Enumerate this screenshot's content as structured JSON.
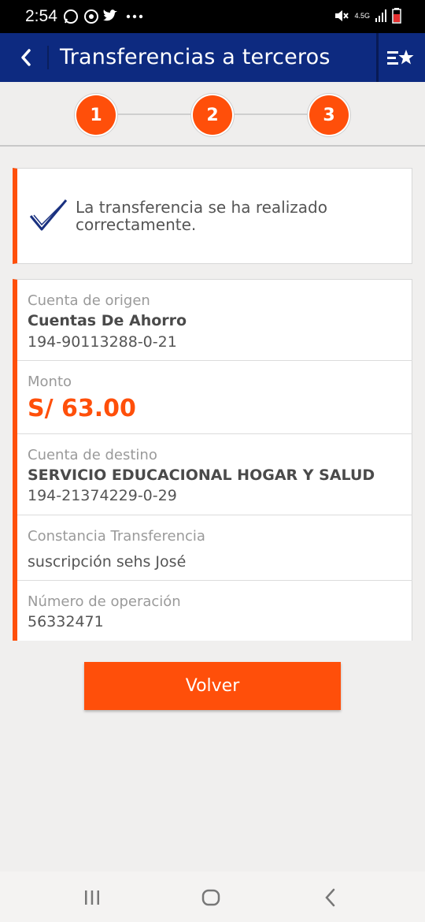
{
  "status": {
    "time": "2:54",
    "network": "4.5G"
  },
  "header": {
    "title": "Transferencias a terceros"
  },
  "stepper": {
    "steps": [
      "1",
      "2",
      "3"
    ]
  },
  "success": {
    "message": "La transferencia se ha realizado correctamente."
  },
  "details": {
    "origin": {
      "label": "Cuenta de origen",
      "name": "Cuentas De Ahorro",
      "number": "194-90113288-0-21"
    },
    "amount": {
      "label": "Monto",
      "value": "S/ 63.00"
    },
    "destination": {
      "label": "Cuenta de destino",
      "name": "SERVICIO EDUCACIONAL HOGAR Y SALUD",
      "number": "194-21374229-0-29"
    },
    "receipt": {
      "label": "Constancia Transferencia",
      "value": "suscripción sehs José"
    },
    "operation": {
      "label": "Número de operación",
      "value": "56332471"
    }
  },
  "actions": {
    "back_label": "Volver"
  },
  "colors": {
    "brand": "#0d2a80",
    "accent": "#ff4f0a"
  },
  "icons": [
    "whatsapp-icon",
    "signal-app-icon",
    "twitter-icon",
    "more-dots-icon",
    "mute-icon",
    "cell-signal-icon",
    "battery-icon",
    "back-chevron-icon",
    "favorites-list-icon",
    "checkmark-icon",
    "recents-icon",
    "home-icon",
    "nav-back-icon"
  ]
}
